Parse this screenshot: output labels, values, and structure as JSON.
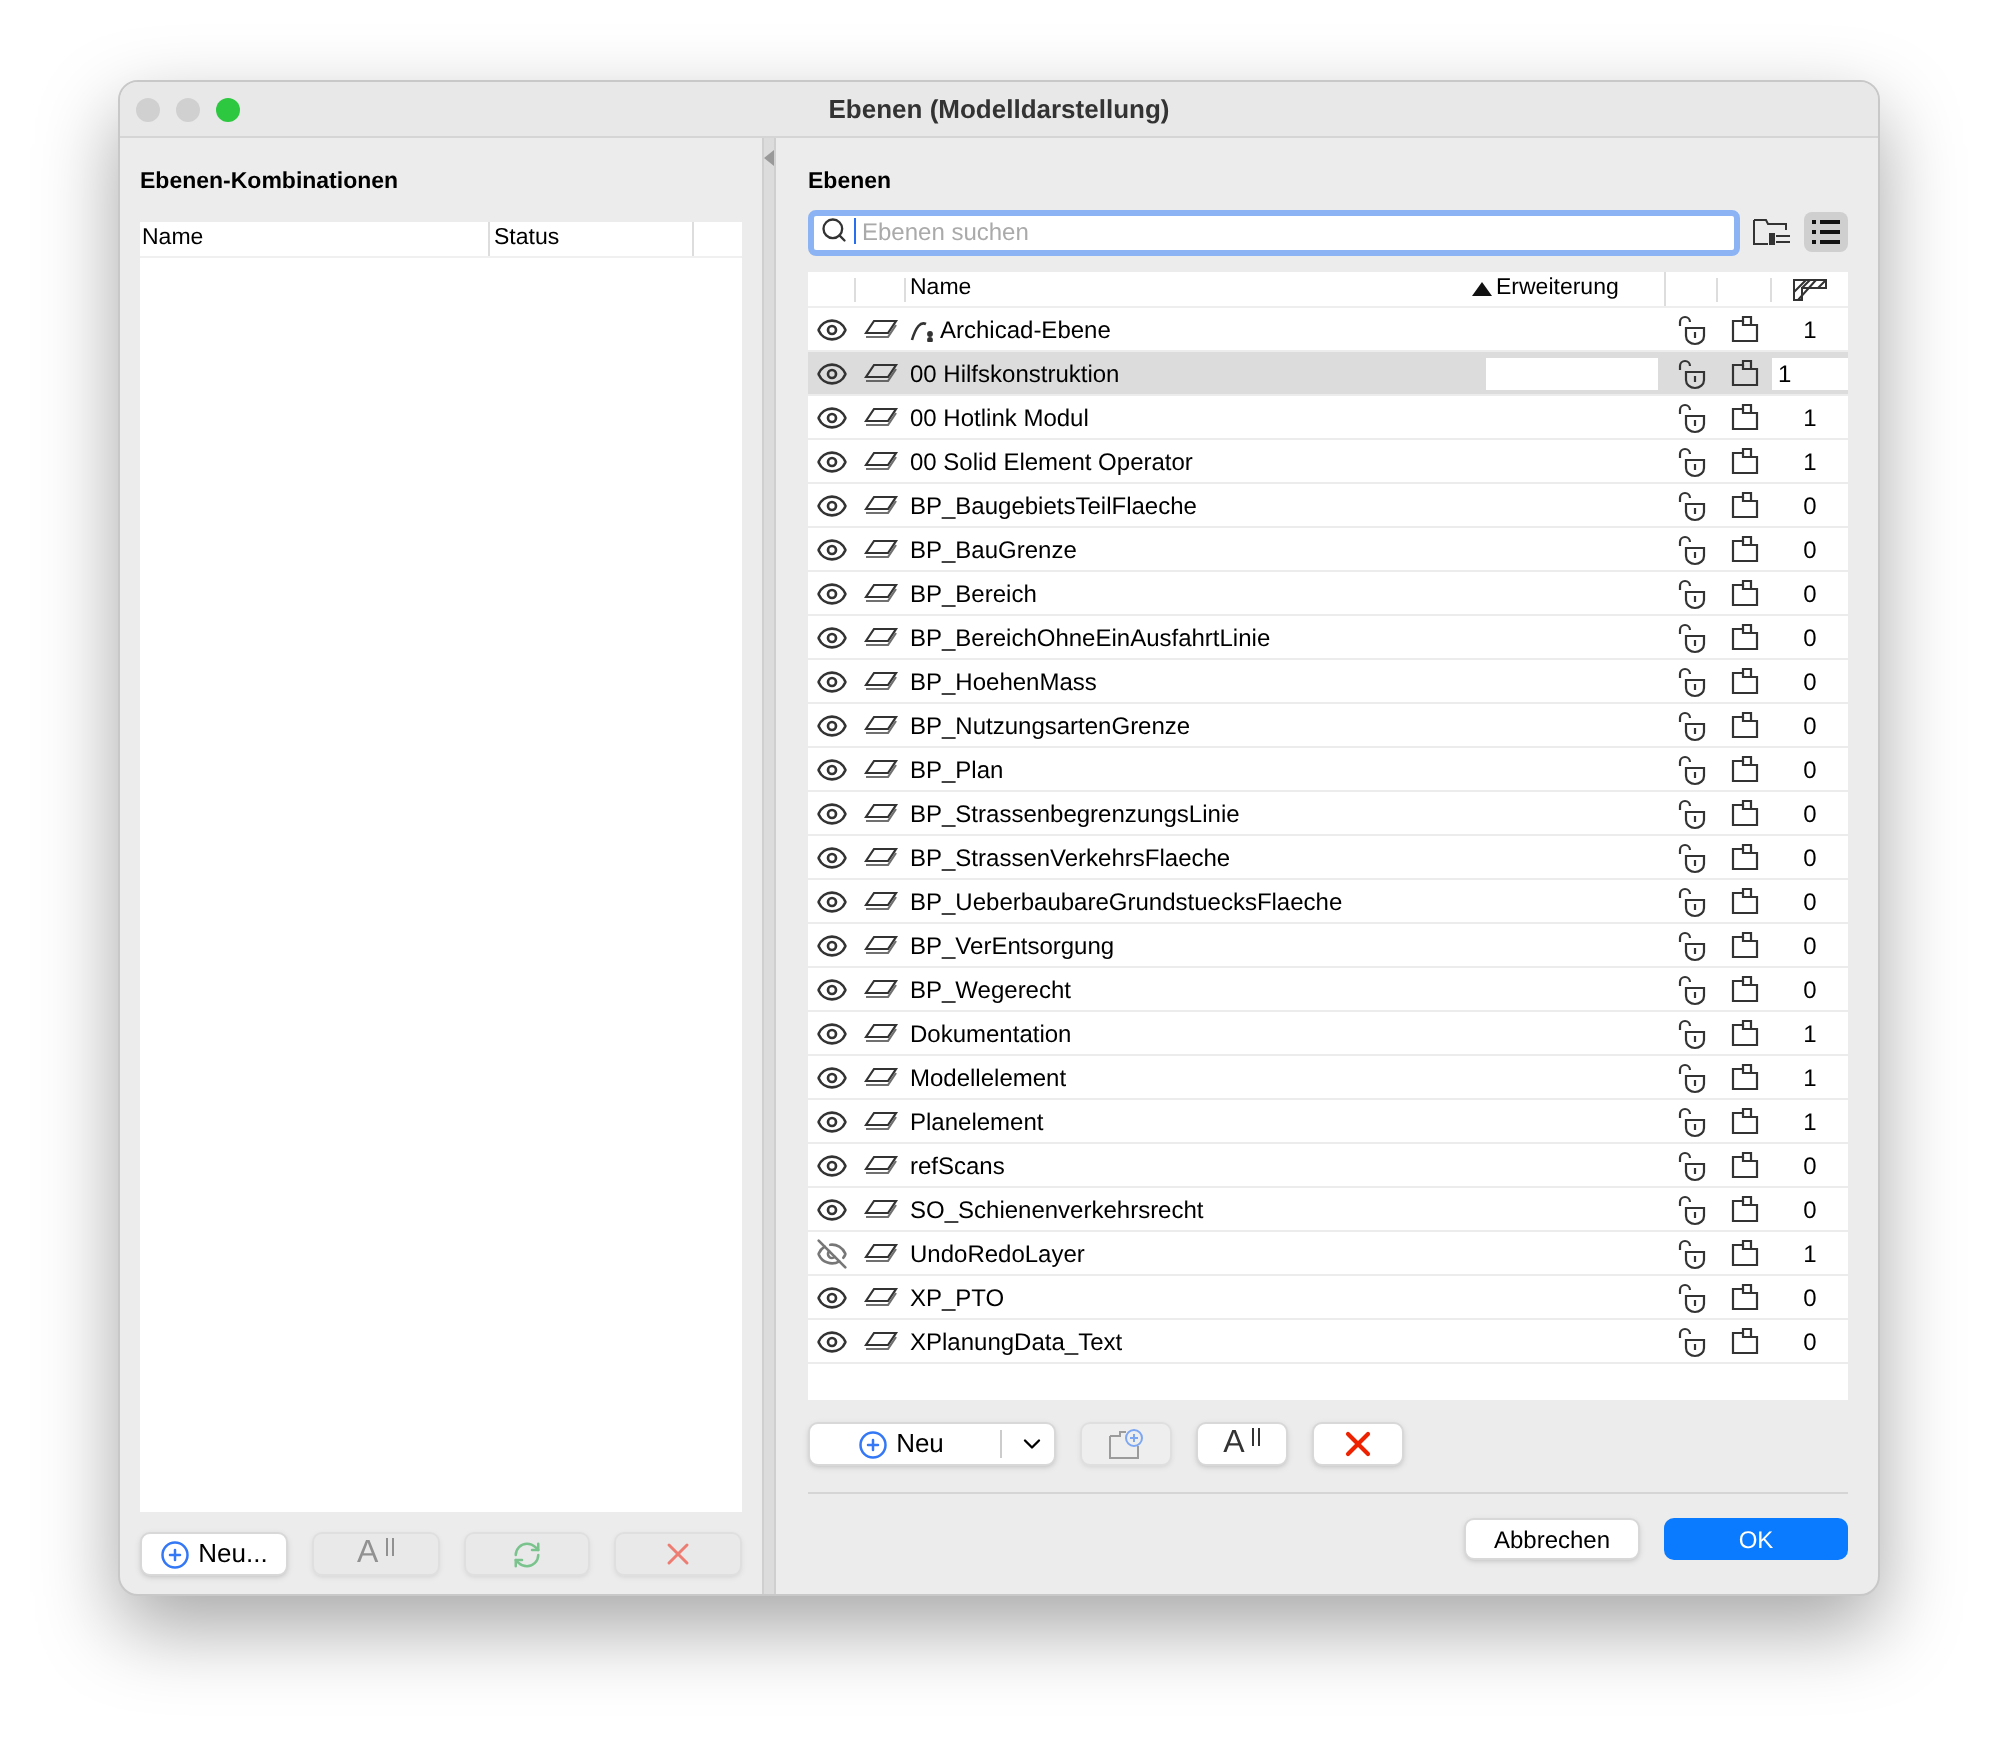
{
  "window": {
    "title": "Ebenen (Modelldarstellung)"
  },
  "combinations": {
    "title": "Ebenen-Kombinationen",
    "columns": [
      "Name",
      "Status"
    ],
    "buttons": [
      {
        "kind": "new",
        "label": "Neu...",
        "disabled": false
      },
      {
        "kind": "rename",
        "label": "A",
        "disabled": true
      },
      {
        "kind": "refresh",
        "disabled": true
      },
      {
        "kind": "delete",
        "disabled": true
      }
    ]
  },
  "layers": {
    "title": "Ebenen",
    "search": {
      "placeholder": "Ebenen suchen"
    },
    "columns": {
      "name": "Name",
      "extension": "Erweiterung"
    },
    "rows": [
      {
        "kind": "archicad",
        "name": "Archicad-Ebene",
        "visible": true,
        "selected": false,
        "value": "1"
      },
      {
        "kind": "layer",
        "name": "00 Hilfskonstruktion",
        "visible": true,
        "selected": true,
        "value": "1"
      },
      {
        "kind": "layer",
        "name": "00 Hotlink Modul",
        "visible": true,
        "selected": false,
        "value": "1"
      },
      {
        "kind": "layer",
        "name": "00 Solid Element Operator",
        "visible": true,
        "selected": false,
        "value": "1"
      },
      {
        "kind": "layer",
        "name": "BP_BaugebietsTeilFlaeche",
        "visible": true,
        "selected": false,
        "value": "0"
      },
      {
        "kind": "layer",
        "name": "BP_BauGrenze",
        "visible": true,
        "selected": false,
        "value": "0"
      },
      {
        "kind": "layer",
        "name": "BP_Bereich",
        "visible": true,
        "selected": false,
        "value": "0"
      },
      {
        "kind": "layer",
        "name": "BP_BereichOhneEinAusfahrtLinie",
        "visible": true,
        "selected": false,
        "value": "0"
      },
      {
        "kind": "layer",
        "name": "BP_HoehenMass",
        "visible": true,
        "selected": false,
        "value": "0"
      },
      {
        "kind": "layer",
        "name": "BP_NutzungsartenGrenze",
        "visible": true,
        "selected": false,
        "value": "0"
      },
      {
        "kind": "layer",
        "name": "BP_Plan",
        "visible": true,
        "selected": false,
        "value": "0"
      },
      {
        "kind": "layer",
        "name": "BP_StrassenbegrenzungsLinie",
        "visible": true,
        "selected": false,
        "value": "0"
      },
      {
        "kind": "layer",
        "name": "BP_StrassenVerkehrsFlaeche",
        "visible": true,
        "selected": false,
        "value": "0"
      },
      {
        "kind": "layer",
        "name": "BP_UeberbaubareGrundstuecksFlaeche",
        "visible": true,
        "selected": false,
        "value": "0"
      },
      {
        "kind": "layer",
        "name": "BP_VerEntsorgung",
        "visible": true,
        "selected": false,
        "value": "0"
      },
      {
        "kind": "layer",
        "name": "BP_Wegerecht",
        "visible": true,
        "selected": false,
        "value": "0"
      },
      {
        "kind": "layer",
        "name": "Dokumentation",
        "visible": true,
        "selected": false,
        "value": "1"
      },
      {
        "kind": "layer",
        "name": "Modellelement",
        "visible": true,
        "selected": false,
        "value": "1"
      },
      {
        "kind": "layer",
        "name": "Planelement",
        "visible": true,
        "selected": false,
        "value": "1"
      },
      {
        "kind": "layer",
        "name": "refScans",
        "visible": true,
        "selected": false,
        "value": "0"
      },
      {
        "kind": "layer",
        "name": "SO_Schienenverkehrsrecht",
        "visible": true,
        "selected": false,
        "value": "0"
      },
      {
        "kind": "layer",
        "name": "UndoRedoLayer",
        "visible": false,
        "selected": false,
        "value": "1"
      },
      {
        "kind": "layer",
        "name": "XP_PTO",
        "visible": true,
        "selected": false,
        "value": "0"
      },
      {
        "kind": "layer",
        "name": "XPlanungData_Text",
        "visible": true,
        "selected": false,
        "value": "0"
      }
    ],
    "buttons": [
      {
        "kind": "new",
        "label": "Neu",
        "disabled": false
      },
      {
        "kind": "new-folder",
        "disabled": true
      },
      {
        "kind": "rename",
        "label": "A",
        "disabled": false
      },
      {
        "kind": "delete",
        "disabled": false
      }
    ]
  },
  "footer": {
    "cancel": "Abbrechen",
    "ok": "OK"
  }
}
